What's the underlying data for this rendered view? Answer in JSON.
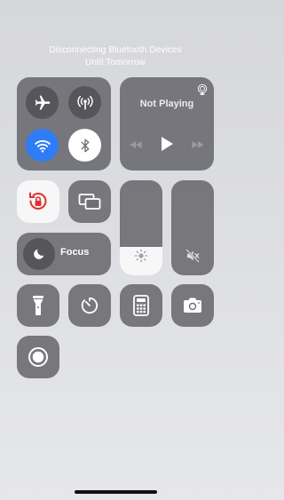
{
  "banner": {
    "line1": "Disconnecting Bluetooth Devices",
    "line2": "Until Tomorrow"
  },
  "connectivity": {
    "airplane": {
      "icon": "airplane-icon",
      "on": false
    },
    "cellular": {
      "icon": "cellular-antenna-icon",
      "on": false
    },
    "wifi": {
      "icon": "wifi-icon",
      "on": true,
      "color": "#2f7cf6"
    },
    "bluetooth": {
      "icon": "bluetooth-icon",
      "on": false,
      "state_color": "#ffffff"
    }
  },
  "now_playing": {
    "title": "Not Playing",
    "airplay_icon": "airplay-icon",
    "controls": [
      "rewind-icon",
      "play-icon",
      "fast-forward-icon"
    ]
  },
  "orientation_lock": {
    "icon": "orientation-lock-icon",
    "on": true,
    "color": "#e0302e"
  },
  "screen_mirroring": {
    "icon": "screen-mirroring-icon"
  },
  "focus": {
    "label": "Focus",
    "icon": "moon-icon"
  },
  "brightness": {
    "icon": "sun-icon",
    "level": 0.3
  },
  "volume": {
    "icon": "speaker-muted-icon",
    "level": 0.0
  },
  "shortcuts": [
    {
      "name": "flashlight",
      "icon": "flashlight-icon"
    },
    {
      "name": "timer",
      "icon": "timer-icon"
    },
    {
      "name": "calculator",
      "icon": "calculator-icon"
    },
    {
      "name": "camera",
      "icon": "camera-icon"
    }
  ],
  "screen_recording": {
    "icon": "screen-record-icon"
  }
}
